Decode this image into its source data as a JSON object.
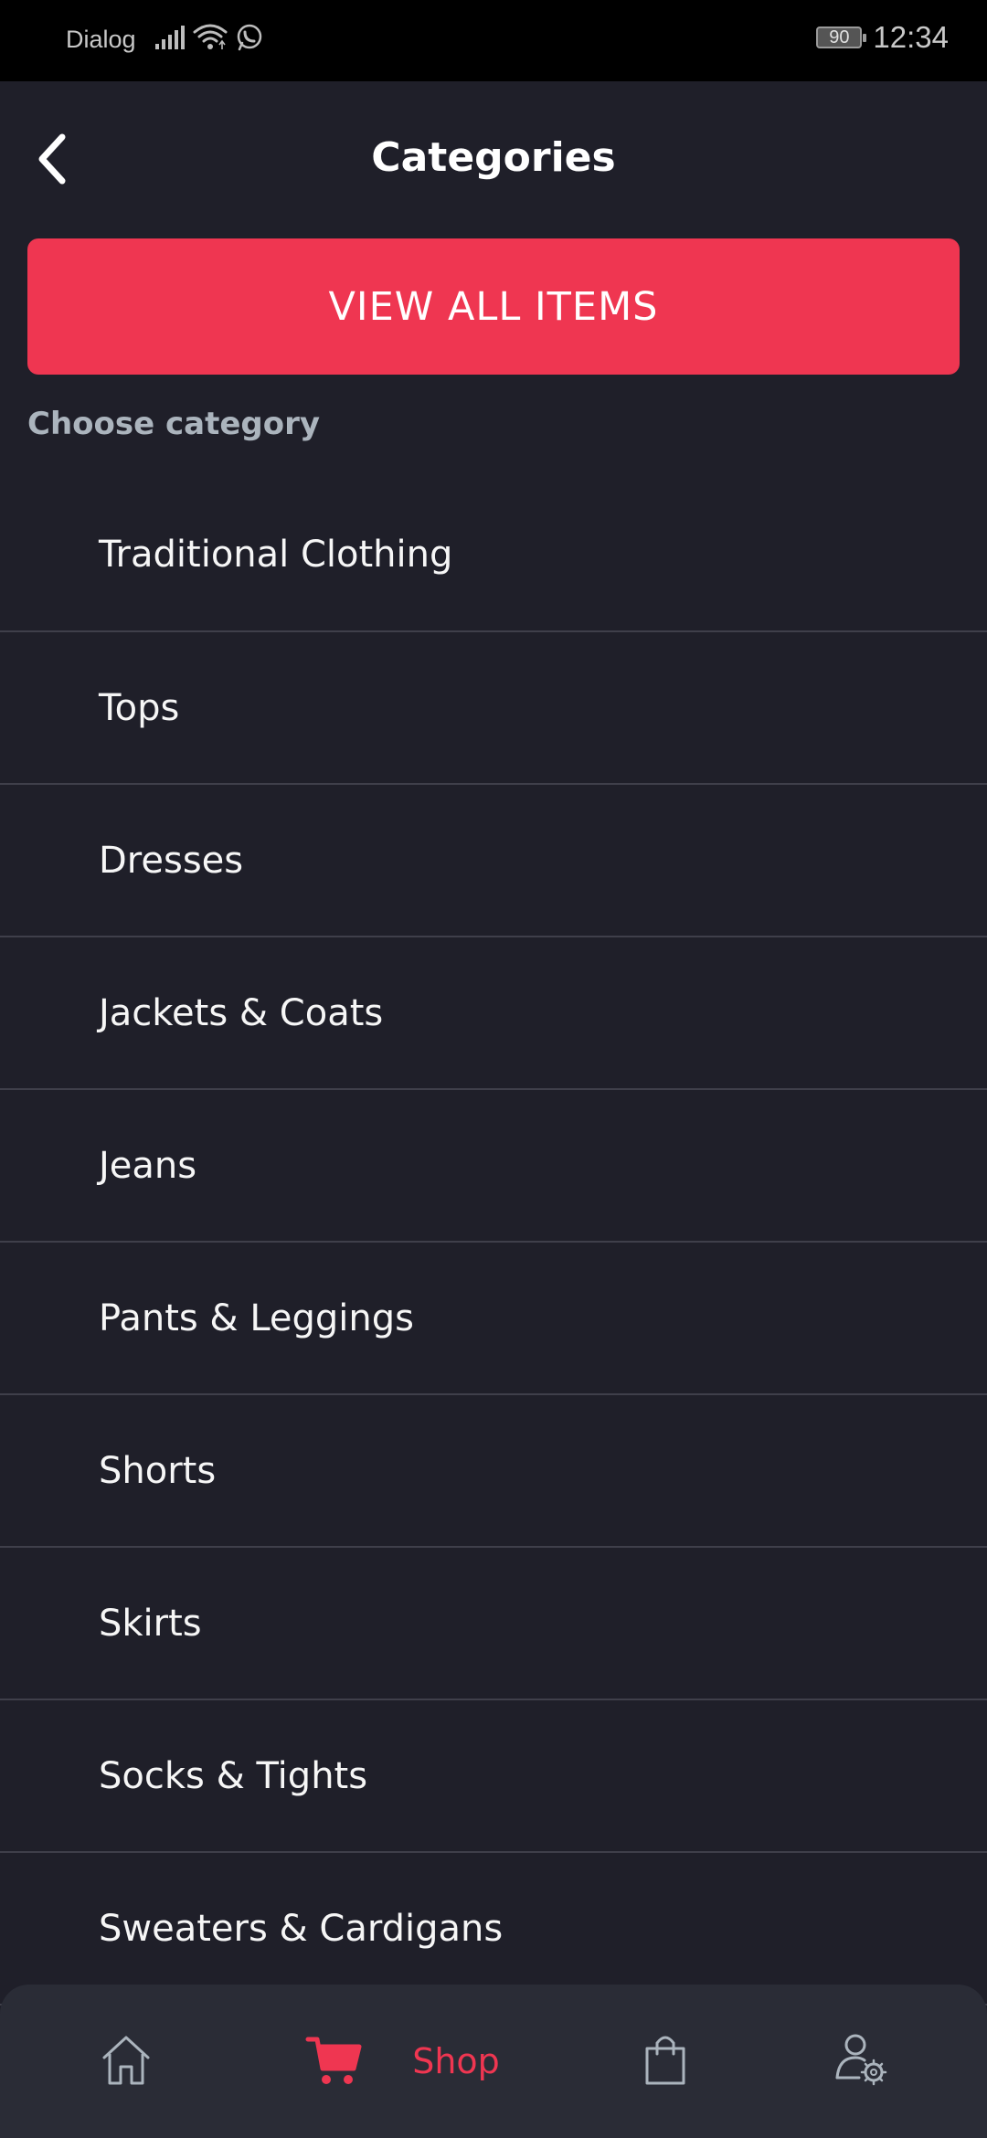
{
  "status_bar": {
    "carrier": "Dialog",
    "battery": "90",
    "time": "12:34"
  },
  "header": {
    "title": "Categories",
    "back_icon": "chevron-left-icon"
  },
  "cta": {
    "label": "VIEW ALL ITEMS",
    "color": "#ef3651"
  },
  "section": {
    "label": "Choose category"
  },
  "categories": [
    {
      "label": "Traditional Clothing"
    },
    {
      "label": "Tops"
    },
    {
      "label": "Dresses"
    },
    {
      "label": "Jackets & Coats"
    },
    {
      "label": "Jeans"
    },
    {
      "label": "Pants & Leggings"
    },
    {
      "label": "Shorts"
    },
    {
      "label": "Skirts"
    },
    {
      "label": "Socks & Tights"
    },
    {
      "label": "Sweaters & Cardigans"
    }
  ],
  "bottom_nav": {
    "items": [
      {
        "icon": "home-icon",
        "label": "",
        "active": false
      },
      {
        "icon": "cart-icon",
        "label": "Shop",
        "active": true
      },
      {
        "icon": "bag-icon",
        "label": "",
        "active": false
      },
      {
        "icon": "profile-settings-icon",
        "label": "",
        "active": false
      }
    ],
    "active_color": "#ef3651",
    "inactive_color": "#abb4bd"
  }
}
